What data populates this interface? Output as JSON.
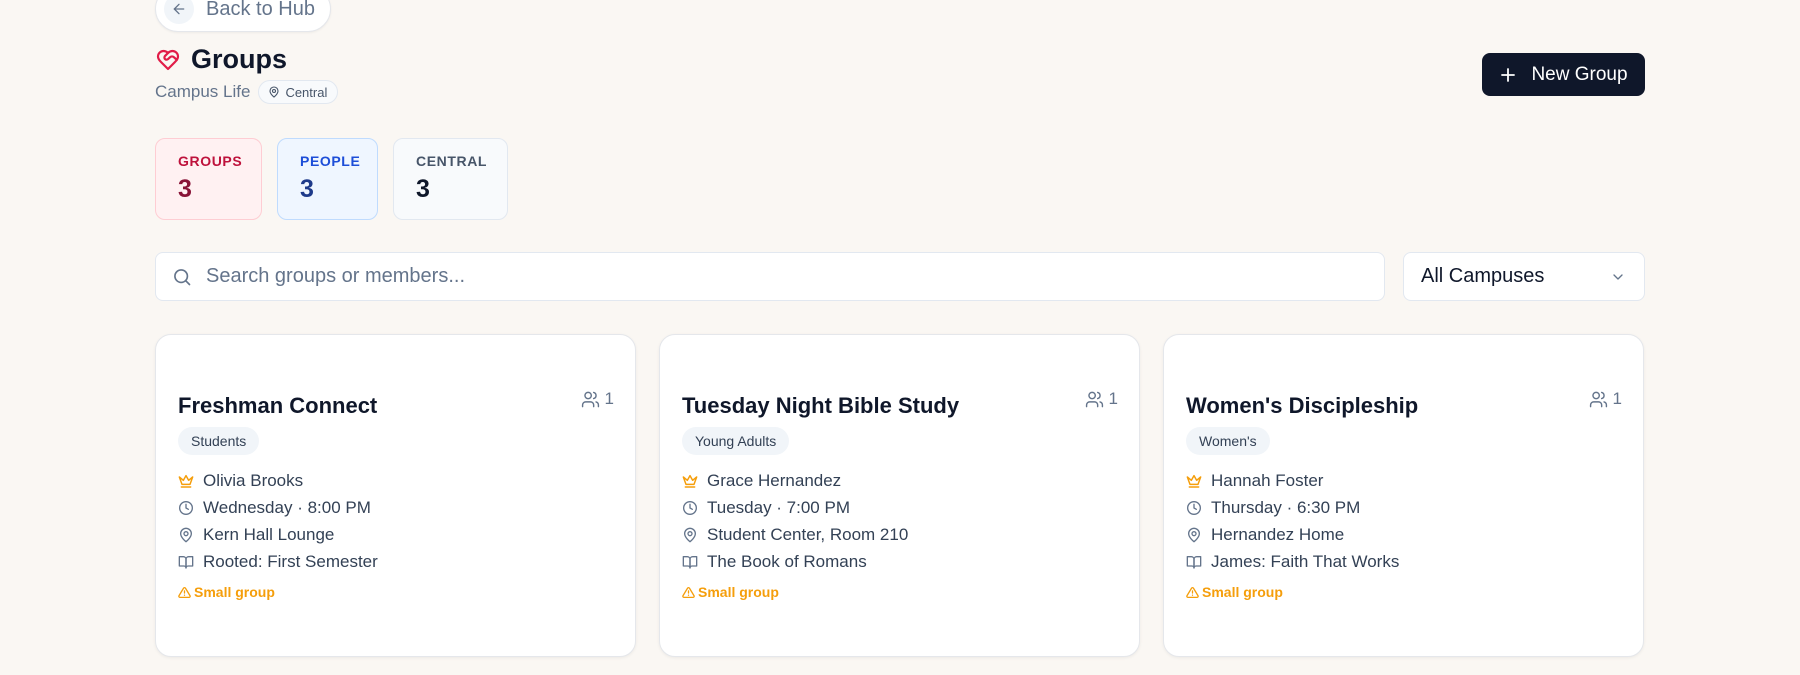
{
  "nav": {
    "back_label": "Back to Hub"
  },
  "header": {
    "title": "Groups",
    "subtitle": "Campus Life",
    "campus_badge": "Central",
    "new_button": "New Group"
  },
  "stats": [
    {
      "label": "GROUPS",
      "value": "3"
    },
    {
      "label": "PEOPLE",
      "value": "3"
    },
    {
      "label": "CENTRAL",
      "value": "3"
    }
  ],
  "search": {
    "placeholder": "Search groups or members..."
  },
  "filter": {
    "selected": "All Campuses"
  },
  "groups": [
    {
      "name": "Freshman Connect",
      "members": "1",
      "tag": "Students",
      "leader": "Olivia Brooks",
      "schedule": "Wednesday · 8:00 PM",
      "location": "Kern Hall Lounge",
      "curriculum": "Rooted: First Semester",
      "warning": "Small group"
    },
    {
      "name": "Tuesday Night Bible Study",
      "members": "1",
      "tag": "Young Adults",
      "leader": "Grace Hernandez",
      "schedule": "Tuesday · 7:00 PM",
      "location": "Student Center, Room 210",
      "curriculum": "The Book of Romans",
      "warning": "Small group"
    },
    {
      "name": "Women's Discipleship",
      "members": "1",
      "tag": "Women's",
      "leader": "Hannah Foster",
      "schedule": "Thursday · 6:30 PM",
      "location": "Hernandez Home",
      "curriculum": "James: Faith That Works",
      "warning": "Small group"
    }
  ],
  "colors": {
    "accent": "#e11d48",
    "primary_button": "#0f172a",
    "leader_icon": "#f59e0b",
    "warning": "#f59e0b"
  },
  "icons": {
    "back": "arrow-left-icon",
    "title": "heart-handshake-icon",
    "campus": "map-pin-icon",
    "new": "plus-icon",
    "search": "search-icon",
    "filter": "chevron-down-icon",
    "members": "users-icon",
    "leader": "crown-icon",
    "schedule": "clock-icon",
    "location": "map-pin-icon",
    "curriculum": "book-open-icon",
    "warning": "alert-triangle-icon"
  }
}
